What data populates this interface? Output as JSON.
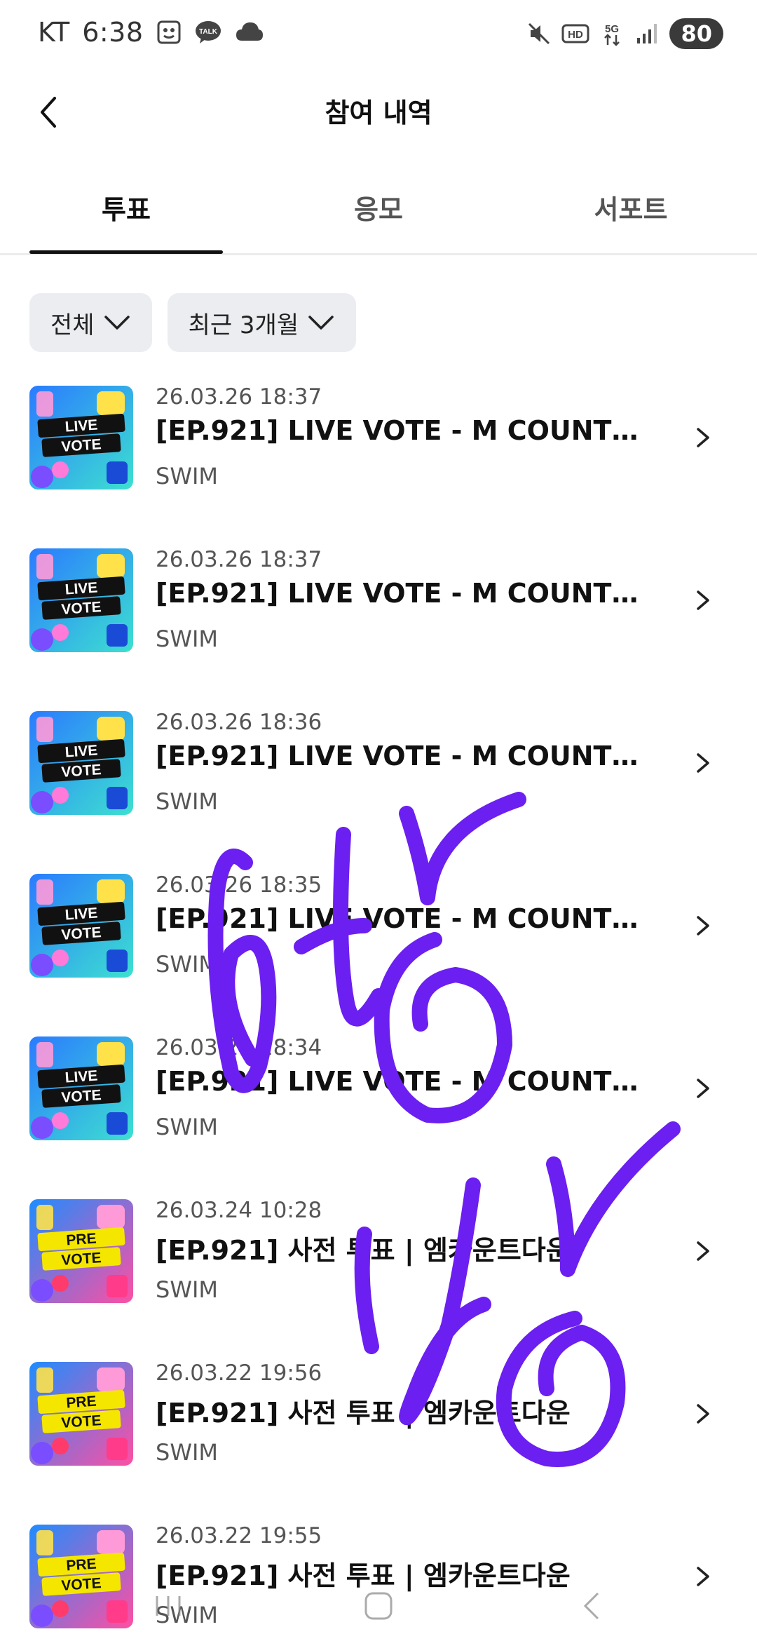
{
  "status_bar": {
    "carrier": "KT",
    "time": "6:38",
    "battery": "80",
    "icons": [
      "screenshot-icon",
      "talk-icon",
      "cloud-icon",
      "mute-icon",
      "hd-icon",
      "5g-icon",
      "signal-icon"
    ],
    "talk_label": "TALK",
    "hd_label": "HD",
    "network_label": "5G"
  },
  "header": {
    "title": "참여 내역",
    "back_icon": "chevron-left-icon"
  },
  "tabs": [
    {
      "label": "투표",
      "active": true
    },
    {
      "label": "응모",
      "active": false
    },
    {
      "label": "서포트",
      "active": false
    }
  ],
  "filters": [
    {
      "label": "전체"
    },
    {
      "label": "최근 3개월"
    }
  ],
  "items": [
    {
      "date": "26.03.26 18:37",
      "title": "[EP.921] LIVE VOTE - M COUNTDO...",
      "sub": "SWIM",
      "thumb": "live-vote",
      "thumb_line1": "LIVE",
      "thumb_line2": "VOTE"
    },
    {
      "date": "26.03.26 18:37",
      "title": "[EP.921] LIVE VOTE - M COUNTDO...",
      "sub": "SWIM",
      "thumb": "live-vote",
      "thumb_line1": "LIVE",
      "thumb_line2": "VOTE"
    },
    {
      "date": "26.03.26 18:36",
      "title": "[EP.921] LIVE VOTE - M COUNTDO...",
      "sub": "SWIM",
      "thumb": "live-vote",
      "thumb_line1": "LIVE",
      "thumb_line2": "VOTE"
    },
    {
      "date": "26.03.26 18:35",
      "title": "[EP.921] LIVE VOTE - M COUNTDO...",
      "sub": "SWIM",
      "thumb": "live-vote",
      "thumb_line1": "LIVE",
      "thumb_line2": "VOTE"
    },
    {
      "date": "26.03.26 18:34",
      "title": "[EP.921] LIVE VOTE - M COUNTDO...",
      "sub": "SWIM",
      "thumb": "live-vote",
      "thumb_line1": "LIVE",
      "thumb_line2": "VOTE"
    },
    {
      "date": "26.03.24 10:28",
      "title": "[EP.921] 사전 투표 | 엠카운트다운",
      "sub": "SWIM",
      "thumb": "pre-vote",
      "thumb_line1": "PRE",
      "thumb_line2": "VOTE"
    },
    {
      "date": "26.03.22 19:56",
      "title": "[EP.921] 사전 투표 | 엠카운트다운",
      "sub": "SWIM",
      "thumb": "pre-vote",
      "thumb_line1": "PRE",
      "thumb_line2": "VOTE"
    },
    {
      "date": "26.03.22 19:55",
      "title": "[EP.921] 사전 투표 | 엠카운트다운",
      "sub": "SWIM",
      "thumb": "pre-vote",
      "thumb_line1": "PRE",
      "thumb_line2": "VOTE"
    }
  ],
  "colors": {
    "scribble": "#6b1ff0",
    "filter_bg": "#ebedf0",
    "tab_indicator": "#111111"
  },
  "nav_bar": {
    "buttons": [
      "recents-icon",
      "home-icon",
      "back-icon"
    ]
  }
}
